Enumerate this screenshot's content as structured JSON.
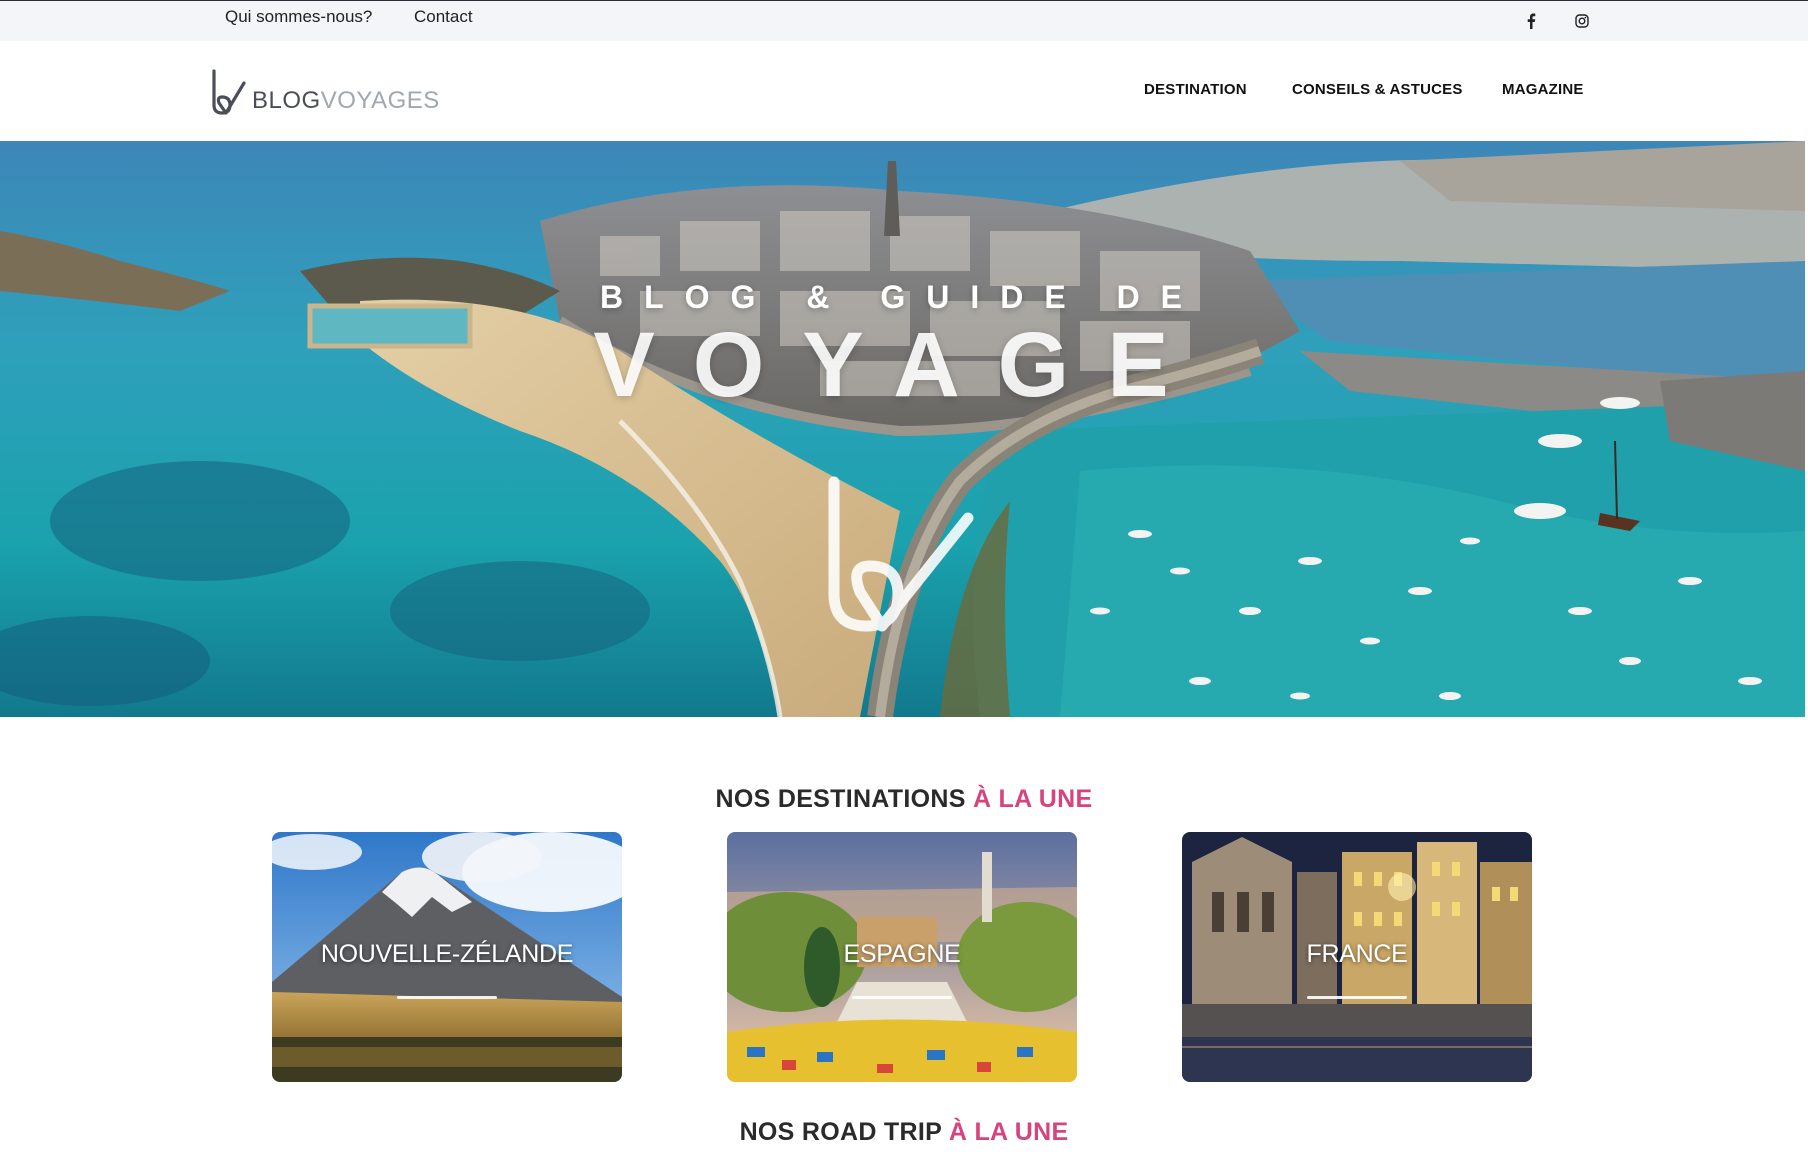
{
  "topbar": {
    "links": [
      "Qui sommes-nous?",
      "Contact"
    ],
    "social": [
      "facebook-icon",
      "instagram-icon"
    ]
  },
  "header": {
    "logo": {
      "part1": "BLOG",
      "part2": "VOYAGES"
    },
    "nav": [
      "DESTINATION",
      "CONSEILS & ASTUCES",
      "MAGAZINE"
    ]
  },
  "hero": {
    "subtitle": "BLOG & GUIDE DE",
    "title": "VOYAGE"
  },
  "destinations": {
    "title": "NOS DESTINATIONS",
    "accent": "À LA UNE",
    "cards": [
      {
        "label": "NOUVELLE-ZÉLANDE"
      },
      {
        "label": "ESPAGNE"
      },
      {
        "label": "FRANCE"
      }
    ]
  },
  "roadtrip": {
    "title": "NOS ROAD TRIP",
    "accent": "À LA UNE"
  },
  "colors": {
    "accent": "#d6437f",
    "topbar_bg": "#f4f5f9",
    "logo_dark": "#4a4f57",
    "logo_light": "#a1a7ae"
  }
}
